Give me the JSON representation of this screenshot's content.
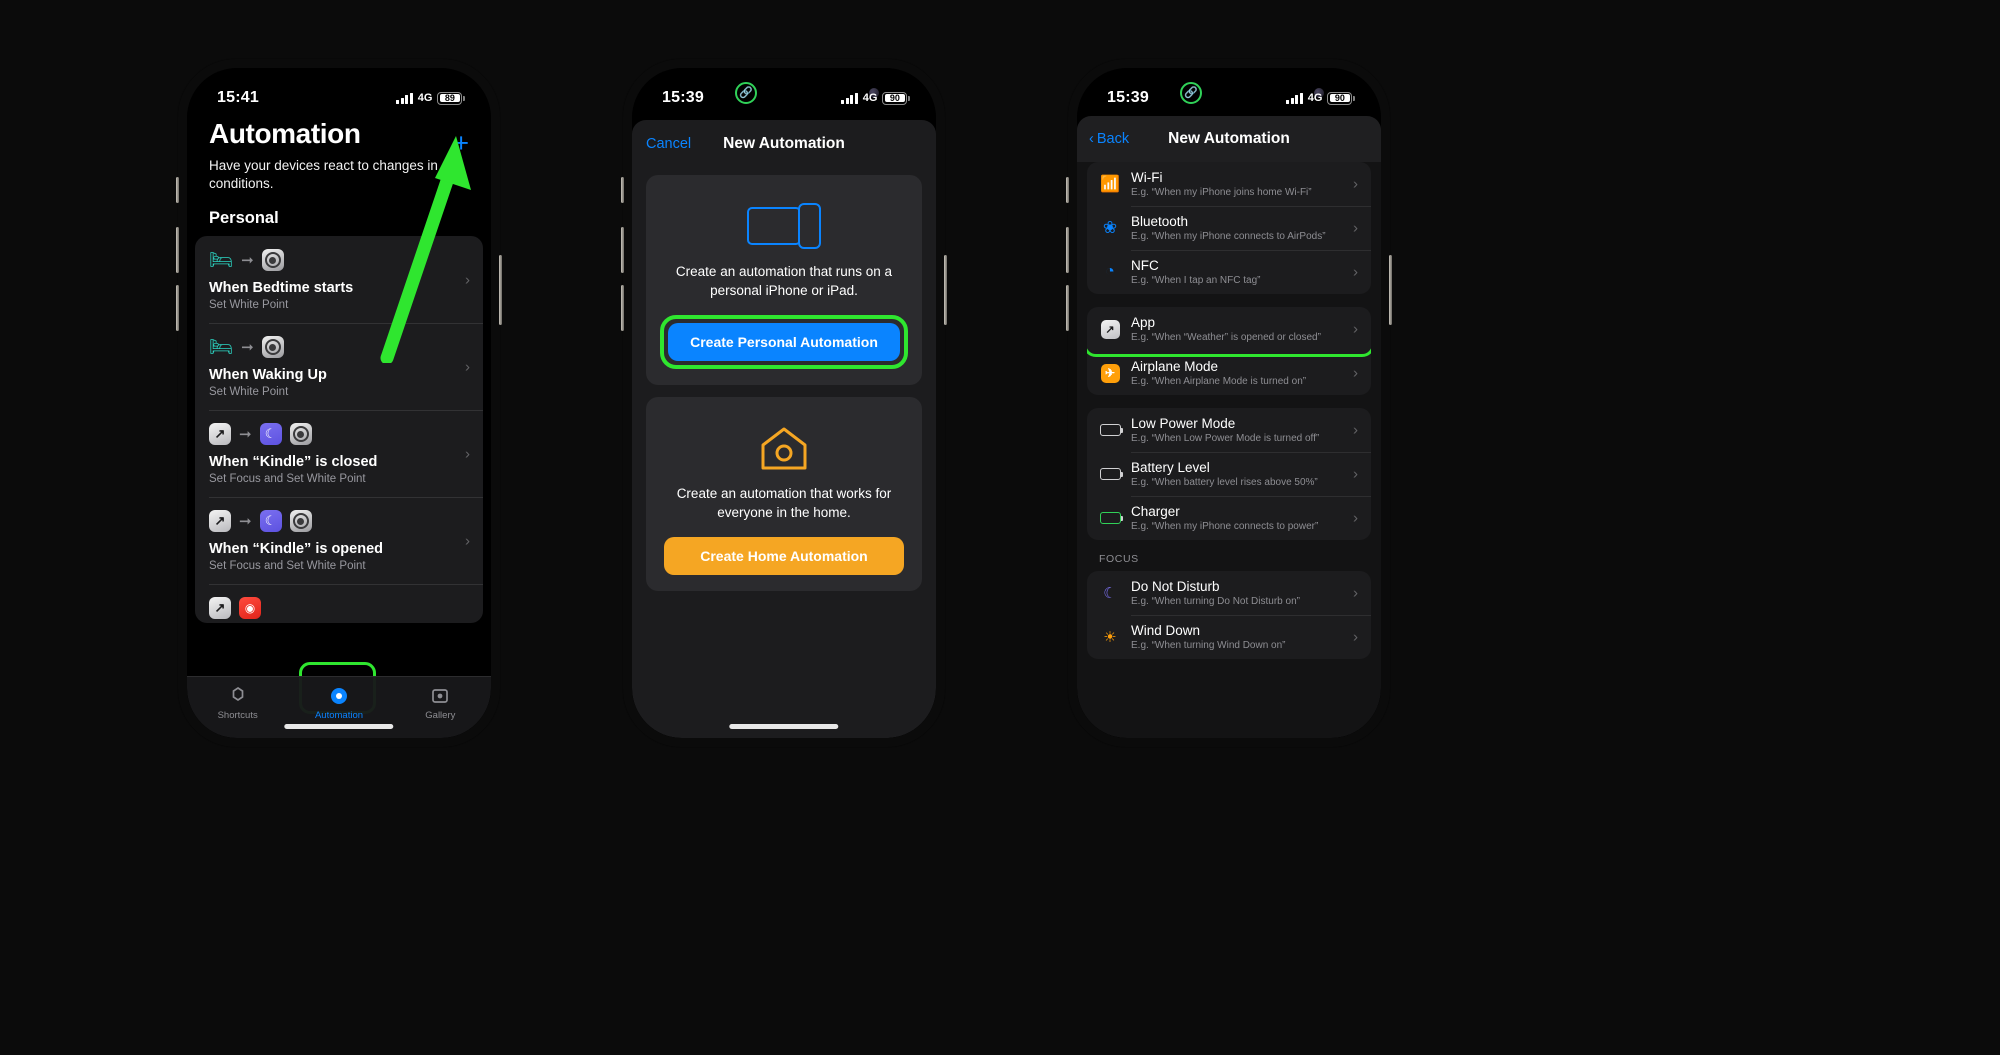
{
  "phone1": {
    "status": {
      "time": "15:41",
      "network": "4G",
      "battery": "89"
    },
    "nav": {
      "add_label": "+"
    },
    "header": {
      "title": "Automation",
      "subtitle": "Have your devices react to changes in conditions.",
      "section": "Personal"
    },
    "automations": [
      {
        "name": "When Bedtime starts",
        "desc": "Set White Point",
        "icons": [
          "bed",
          "accessibility"
        ]
      },
      {
        "name": "When Waking Up",
        "desc": "Set White Point",
        "icons": [
          "bed",
          "accessibility"
        ]
      },
      {
        "name": "When “Kindle” is closed",
        "desc": "Set Focus and Set White Point",
        "icons": [
          "shortcut",
          "focus",
          "accessibility"
        ]
      },
      {
        "name": "When “Kindle” is opened",
        "desc": "Set Focus and Set White Point",
        "icons": [
          "shortcut",
          "focus",
          "accessibility"
        ]
      },
      {
        "name": "",
        "desc": "",
        "icons": [
          "shortcut",
          "red"
        ]
      }
    ],
    "tabs": [
      {
        "label": "Shortcuts",
        "icon": "shortcuts-icon",
        "active": false
      },
      {
        "label": "Automation",
        "icon": "automation-icon",
        "active": true
      },
      {
        "label": "Gallery",
        "icon": "gallery-icon",
        "active": false
      }
    ]
  },
  "phone2": {
    "status": {
      "time": "15:39",
      "network": "4G",
      "battery": "90"
    },
    "nav": {
      "cancel": "Cancel",
      "title": "New Automation"
    },
    "personal": {
      "text": "Create an automation that runs on a personal iPhone or iPad.",
      "cta": "Create Personal Automation",
      "art": "devices-icon"
    },
    "home": {
      "text": "Create an automation that works for everyone in the home.",
      "cta": "Create Home Automation",
      "art": "house-icon"
    }
  },
  "phone3": {
    "status": {
      "time": "15:39",
      "network": "4G",
      "battery": "90"
    },
    "nav": {
      "back": "Back",
      "title": "New Automation"
    },
    "groups": [
      {
        "header": "",
        "rows": [
          {
            "name": "Wi-Fi",
            "eg": "E.g. “When my iPhone joins home Wi-Fi”",
            "icon": "wifi-icon"
          },
          {
            "name": "Bluetooth",
            "eg": "E.g. “When my iPhone connects to AirPods”",
            "icon": "bluetooth-icon"
          },
          {
            "name": "NFC",
            "eg": "E.g. “When I tap an NFC tag”",
            "icon": "nfc-icon"
          }
        ]
      },
      {
        "header": "",
        "rows": [
          {
            "name": "App",
            "eg": "E.g. “When “Weather” is opened or closed”",
            "icon": "app-icon",
            "highlighted": true
          },
          {
            "name": "Airplane Mode",
            "eg": "E.g. “When Airplane Mode is turned on”",
            "icon": "airplane-icon"
          }
        ]
      },
      {
        "header": "",
        "rows": [
          {
            "name": "Low Power Mode",
            "eg": "E.g. “When Low Power Mode is turned off”",
            "icon": "low-power-icon"
          },
          {
            "name": "Battery Level",
            "eg": "E.g. “When battery level rises above 50%”",
            "icon": "battery-icon"
          },
          {
            "name": "Charger",
            "eg": "E.g. “When my iPhone connects to power”",
            "icon": "charger-icon"
          }
        ]
      },
      {
        "header": "FOCUS",
        "rows": [
          {
            "name": "Do Not Disturb",
            "eg": "E.g. “When turning Do Not Disturb on”",
            "icon": "moon-icon"
          },
          {
            "name": "Wind Down",
            "eg": "E.g. “When turning Wind Down on”",
            "icon": "wind-down-icon"
          }
        ]
      }
    ]
  },
  "annotations": {
    "highlight_color": "#2fe62f",
    "arrow": "green-arrow-to-add-button"
  }
}
